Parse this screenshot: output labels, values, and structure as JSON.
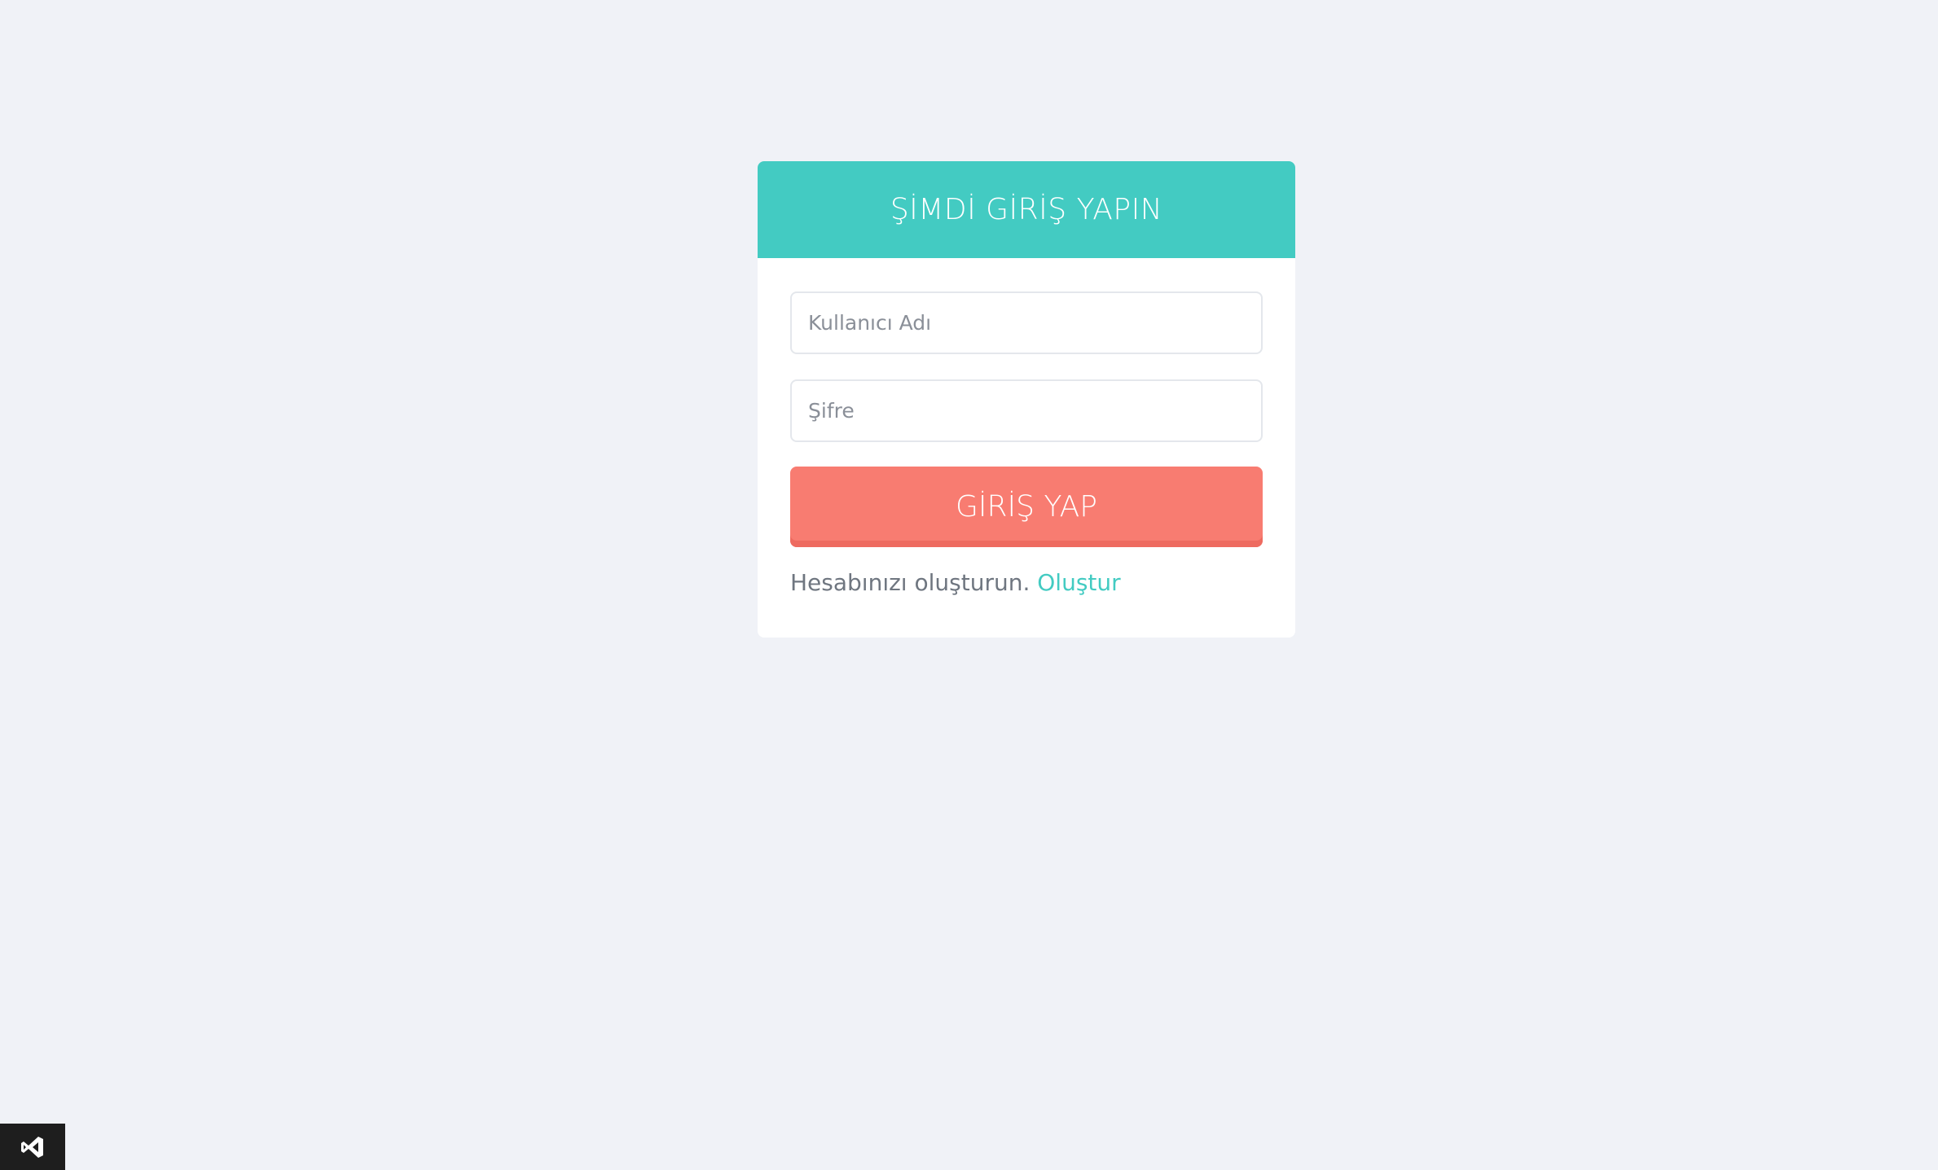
{
  "login": {
    "title": "ŞİMDİ GİRİŞ YAPIN",
    "username_placeholder": "Kullanıcı Adı",
    "password_placeholder": "Şifre",
    "submit_label": "GİRİŞ YAP",
    "signup_prompt": "Hesabınızı oluşturun.",
    "signup_link": "Oluştur"
  },
  "colors": {
    "background": "#f0f2f7",
    "header": "#43cbc2",
    "button": "#f87c71",
    "link": "#43cbc2"
  },
  "icons": {
    "corner_badge": "visual-studio-icon"
  }
}
